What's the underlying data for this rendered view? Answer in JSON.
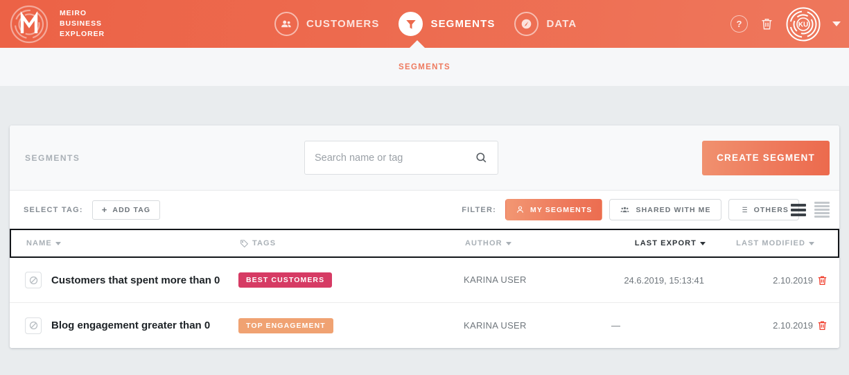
{
  "header": {
    "brand_lines": [
      "MEIRO",
      "BUSINESS",
      "EXPLORER"
    ],
    "nav": [
      {
        "label": "CUSTOMERS",
        "icon": "customers-group-icon",
        "active": false
      },
      {
        "label": "SEGMENTS",
        "icon": "funnel-filter-icon",
        "active": true
      },
      {
        "label": "DATA",
        "icon": "gauge-meter-icon",
        "active": false
      }
    ],
    "help_glyph": "?",
    "trash_icon": "trash-icon",
    "avatar_initials": "KU",
    "caret_icon": "chevron-down-icon",
    "accent": "#ec6a4d"
  },
  "breadcrumb": {
    "label": "SEGMENTS"
  },
  "card_head": {
    "title": "SEGMENTS",
    "search_placeholder": "Search name or tag",
    "search_value": "",
    "search_icon": "search-icon",
    "create_label": "CREATE SEGMENT"
  },
  "filter_bar": {
    "select_tag_label": "SELECT TAG:",
    "add_tag_label": "ADD TAG",
    "add_tag_icon": "plus-icon",
    "filter_label": "FILTER:",
    "filters": [
      {
        "label": "MY SEGMENTS",
        "icon": "user-icon",
        "active": true
      },
      {
        "label": "SHARED WITH ME",
        "icon": "users-icon",
        "active": false
      },
      {
        "label": "OTHERS",
        "icon": "list-icon",
        "active": false
      }
    ],
    "view_toggles": [
      {
        "name": "comfortable-view",
        "active": true
      },
      {
        "name": "compact-view",
        "active": false
      }
    ]
  },
  "table": {
    "columns": [
      {
        "label": "NAME",
        "sortable": true,
        "active": false,
        "icon": null
      },
      {
        "label": "TAGS",
        "sortable": false,
        "active": false,
        "icon": "tag-icon"
      },
      {
        "label": "AUTHOR",
        "sortable": true,
        "active": false,
        "icon": null
      },
      {
        "label": "LAST EXPORT",
        "sortable": true,
        "active": true,
        "icon": null
      },
      {
        "label": "LAST MODIFIED",
        "sortable": true,
        "active": false,
        "icon": null
      }
    ],
    "rows": [
      {
        "icon": "segment-disabled-icon",
        "name": "Customers that spent more than 0",
        "tag": "BEST CUSTOMERS",
        "tag_color": "#d63b64",
        "author": "KARINA USER",
        "last_export": "24.6.2019, 15:13:41",
        "last_modified": "2.10.2019",
        "delete_icon": "trash-icon"
      },
      {
        "icon": "segment-disabled-icon",
        "name": "Blog engagement greater than 0",
        "tag": "TOP ENGAGEMENT",
        "tag_color": "#f0a272",
        "author": "KARINA USER",
        "last_export": "—",
        "last_modified": "2.10.2019",
        "delete_icon": "trash-icon"
      }
    ]
  }
}
